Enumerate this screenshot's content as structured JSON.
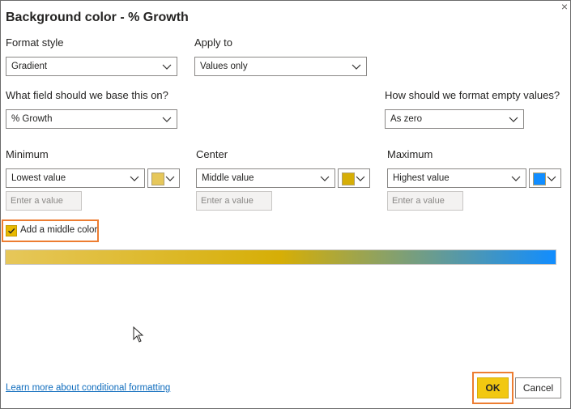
{
  "dialog": {
    "title": "Background color - % Growth",
    "close_glyph": "×"
  },
  "format_style": {
    "label": "Format style",
    "value": "Gradient"
  },
  "apply_to": {
    "label": "Apply to",
    "value": "Values only"
  },
  "base_field": {
    "label": "What field should we base this on?",
    "value": "% Growth"
  },
  "empty_values": {
    "label": "How should we format empty values?",
    "value": "As zero"
  },
  "minimum": {
    "label": "Minimum",
    "value": "Lowest value",
    "color": "#e6c75a",
    "input_placeholder": "Enter a value"
  },
  "center": {
    "label": "Center",
    "value": "Middle value",
    "color": "#d6ae06",
    "input_placeholder": "Enter a value"
  },
  "maximum": {
    "label": "Maximum",
    "value": "Highest value",
    "color": "#118dff",
    "input_placeholder": "Enter a value"
  },
  "middle_color": {
    "label": "Add a middle color",
    "checked": true
  },
  "footer": {
    "learn_more": "Learn more about conditional formatting",
    "ok_label": "OK",
    "cancel_label": "Cancel"
  },
  "colors": {
    "accent_yellow": "#f2c811",
    "highlight_orange": "#ed7d31",
    "link_blue": "#0f6cbd"
  },
  "icons": [
    "close-icon",
    "chevron-down-icon",
    "checkmark-icon",
    "mouse-pointer-icon"
  ]
}
